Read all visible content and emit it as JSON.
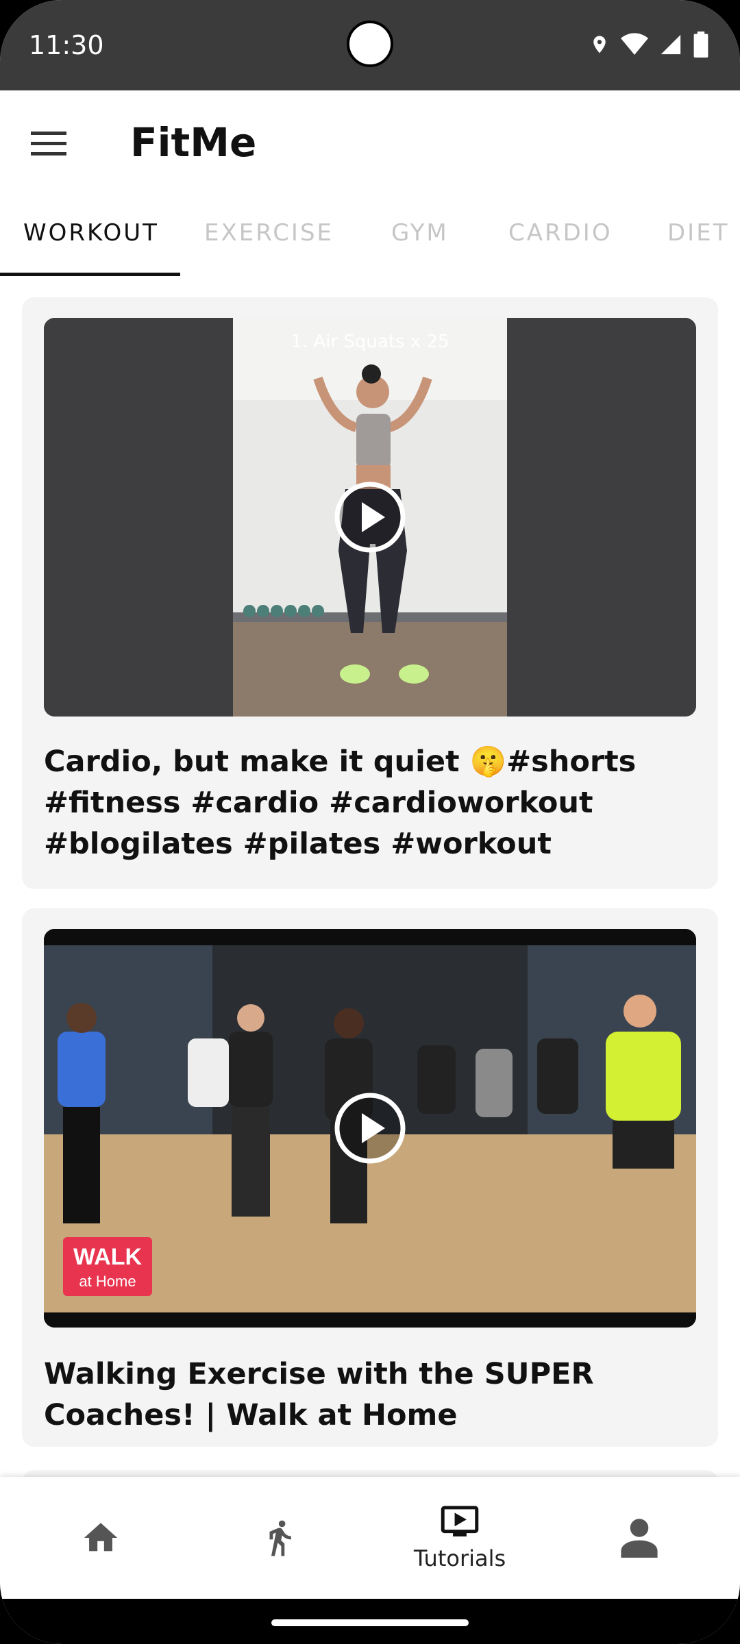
{
  "status": {
    "time": "11:30"
  },
  "app": {
    "title": "FitMe"
  },
  "tabs": [
    {
      "label": "WORKOUT",
      "active": true
    },
    {
      "label": "EXERCISE",
      "active": false
    },
    {
      "label": "GYM",
      "active": false
    },
    {
      "label": "CARDIO",
      "active": false
    },
    {
      "label": "DIET",
      "active": false
    }
  ],
  "videos": [
    {
      "overlay_text": "1. Air Squats x 25",
      "title": "Cardio, but make it quiet 🤫#shorts #fitness #cardio #cardioworkout #blogilates #pilates #workout"
    },
    {
      "logo_text": "WALK at Home",
      "title": "Walking Exercise with the SUPER Coaches! | Walk at Home"
    }
  ],
  "bottom_nav": [
    {
      "icon": "home-icon",
      "label": ""
    },
    {
      "icon": "running-icon",
      "label": ""
    },
    {
      "icon": "video-tutorials-icon",
      "label": "Tutorials",
      "selected": true
    },
    {
      "icon": "profile-icon",
      "label": ""
    }
  ],
  "colors": {
    "status_bar": "#3a3b3a",
    "card_bg": "#f4f4f4",
    "tab_inactive": "#c6c6c6",
    "walk_logo": "#e8344e"
  }
}
